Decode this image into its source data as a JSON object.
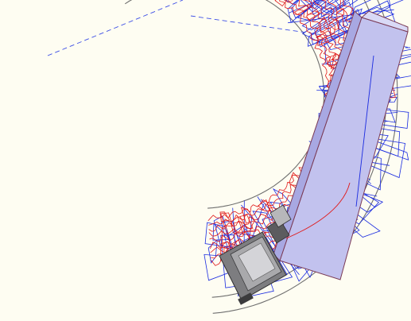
{
  "viewport": {
    "background_color": "#fefdf2",
    "interactive": true
  },
  "colors": {
    "outer_outline": "#6f6f6f",
    "blue_wireframe": "#1a2be0",
    "red_wireframe": "#e01a1a",
    "blue_dashes": "#3b4de6",
    "panel_fill": "#c6c6f0",
    "panel_edge": "#8a4a60",
    "device_fill": "#8d8d8f",
    "device_dark": "#3b3b3d",
    "device_light": "#cfcfd2"
  },
  "objects": [
    {
      "name": "outer-ring-outline"
    },
    {
      "name": "blue-mesh-wireframe"
    },
    {
      "name": "red-mesh-wireframe"
    },
    {
      "name": "long-panel"
    },
    {
      "name": "cartridge-device"
    }
  ]
}
